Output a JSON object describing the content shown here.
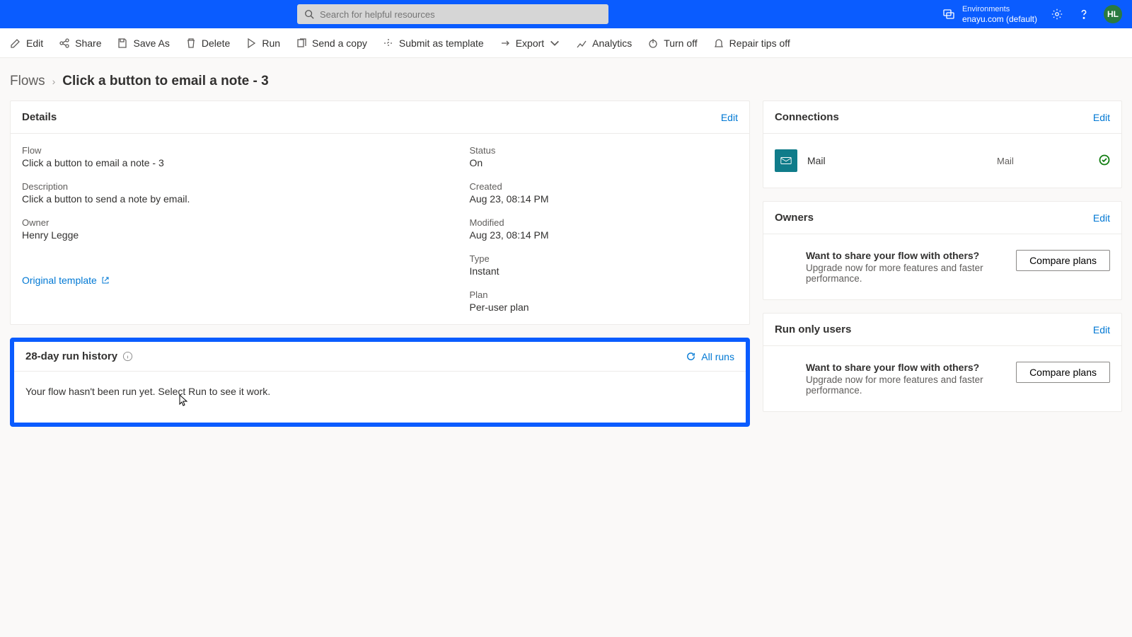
{
  "header": {
    "search_placeholder": "Search for helpful resources",
    "environments_label": "Environments",
    "environment_name": "enayu.com (default)",
    "avatar_initials": "HL"
  },
  "commands": {
    "edit": "Edit",
    "share": "Share",
    "save_as": "Save As",
    "delete": "Delete",
    "run": "Run",
    "send_copy": "Send a copy",
    "submit_template": "Submit as template",
    "export": "Export",
    "analytics": "Analytics",
    "turn_off": "Turn off",
    "repair_tips": "Repair tips off"
  },
  "breadcrumb": {
    "root": "Flows",
    "current": "Click a button to email a note - 3"
  },
  "details": {
    "title": "Details",
    "edit": "Edit",
    "fields": {
      "flow_label": "Flow",
      "flow_value": "Click a button to email a note - 3",
      "description_label": "Description",
      "description_value": "Click a button to send a note by email.",
      "owner_label": "Owner",
      "owner_value": "Henry Legge",
      "status_label": "Status",
      "status_value": "On",
      "created_label": "Created",
      "created_value": "Aug 23, 08:14 PM",
      "modified_label": "Modified",
      "modified_value": "Aug 23, 08:14 PM",
      "type_label": "Type",
      "type_value": "Instant",
      "plan_label": "Plan",
      "plan_value": "Per-user plan"
    },
    "original_template": "Original template"
  },
  "run_history": {
    "title": "28-day run history",
    "all_runs": "All runs",
    "empty_msg": "Your flow hasn't been run yet. Select Run to see it work."
  },
  "connections": {
    "title": "Connections",
    "edit": "Edit",
    "items": [
      {
        "name": "Mail",
        "type": "Mail"
      }
    ]
  },
  "owners": {
    "title": "Owners",
    "edit": "Edit",
    "upsell_headline": "Want to share your flow with others?",
    "upsell_sub": "Upgrade now for more features and faster performance.",
    "compare": "Compare plans"
  },
  "run_only": {
    "title": "Run only users",
    "edit": "Edit",
    "upsell_headline": "Want to share your flow with others?",
    "upsell_sub": "Upgrade now for more features and faster performance.",
    "compare": "Compare plans"
  }
}
